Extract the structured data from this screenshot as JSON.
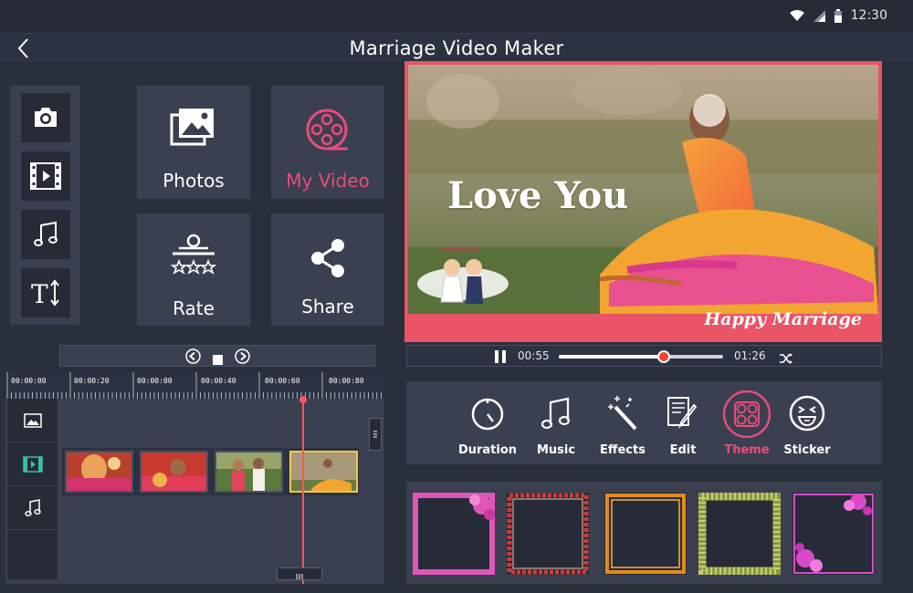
{
  "status_bar": {
    "time": "12:30",
    "icons": [
      "wifi-icon",
      "signal-icon",
      "battery-icon"
    ]
  },
  "header": {
    "title": "Marriage Video Maker",
    "back_icon": "chevron-left-icon"
  },
  "tools": [
    {
      "name": "camera",
      "icon": "camera-icon"
    },
    {
      "name": "video",
      "icon": "film-icon"
    },
    {
      "name": "music",
      "icon": "music-note-icon"
    },
    {
      "name": "text",
      "icon": "text-icon"
    }
  ],
  "tiles": {
    "photos": {
      "label": "Photos",
      "icon": "image-gallery-icon"
    },
    "my_video": {
      "label": "My Video",
      "icon": "film-reel-icon",
      "color": "#e94c7a"
    },
    "rate": {
      "label": "Rate",
      "icon": "rate-stars-icon"
    },
    "share": {
      "label": "Share",
      "icon": "share-icon"
    }
  },
  "preview": {
    "overlay_text": "Love You",
    "caption": "Happy Marriage",
    "sticker_text": "Wedding party",
    "border_color": "#e95466"
  },
  "player": {
    "current_time": "00:55",
    "total_time": "01:26",
    "progress": 0.64,
    "shuffle_icon": "shuffle-icon",
    "pause_icon": "pause-icon"
  },
  "transport": {
    "prev_icon": "previous-icon",
    "stop_icon": "stop-icon",
    "next_icon": "next-icon"
  },
  "timeline": {
    "ruler_labels": [
      "00:00:00",
      "00:00:20",
      "00:00:00",
      "00:00:40",
      "00:00:60",
      "00:00:80"
    ],
    "tracks": [
      "image-track-icon",
      "video-track-icon",
      "music-track-icon"
    ],
    "clips": [
      "clip-1",
      "clip-2",
      "clip-3",
      "clip-4"
    ],
    "selected_clip": 3
  },
  "edit_tools": [
    {
      "label": "Duration",
      "icon": "timer-icon",
      "active": false
    },
    {
      "label": "Music",
      "icon": "music-note-icon",
      "active": false
    },
    {
      "label": "Effects",
      "icon": "magic-wand-icon",
      "active": false
    },
    {
      "label": "Edit",
      "icon": "edit-document-icon",
      "active": false
    },
    {
      "label": "Theme",
      "icon": "theme-icon",
      "active": true
    },
    {
      "label": "Sticker",
      "icon": "emoji-sticker-icon",
      "active": false
    }
  ],
  "accent_color": "#e94c7a",
  "frames": [
    {
      "name": "floral-pink-frame",
      "color": "#e056b8"
    },
    {
      "name": "red-pattern-frame",
      "color": "#d13a3a"
    },
    {
      "name": "orange-gold-frame",
      "color": "#e58a1b"
    },
    {
      "name": "green-lattice-frame",
      "color": "#8d9a3c"
    },
    {
      "name": "pink-roses-frame",
      "color": "#d94ac8"
    }
  ]
}
